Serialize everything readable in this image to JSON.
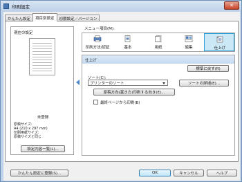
{
  "window": {
    "title": "印刷設定",
    "close_glyph": "✕"
  },
  "tabs": [
    {
      "label": "かんたん設定",
      "active": false
    },
    {
      "label": "項目別設定",
      "active": true
    },
    {
      "label": "初期設定／バージョン",
      "active": false
    }
  ],
  "left_panel": {
    "heading": "現在の設定",
    "status": "未登録",
    "info_lines": [
      "原稿サイズ:",
      "A4 (210 x 297 mm)",
      "印刷用紙サイズ:",
      "原稿サイズと同じ"
    ],
    "settings_list_button": "設定内容一覧(L)...",
    "register_button": "かんたん設定に登録(S)..."
  },
  "menu": {
    "label": "メニュー項目(M):",
    "items": [
      {
        "label": "印刷方法/認証",
        "icon": "print-method-icon"
      },
      {
        "label": "基本",
        "icon": "basic-icon"
      },
      {
        "label": "用紙",
        "icon": "paper-icon"
      },
      {
        "label": "編集",
        "icon": "edit-icon"
      },
      {
        "label": "仕上げ",
        "icon": "finish-icon",
        "selected": true
      }
    ]
  },
  "finishing": {
    "title": "仕上げ",
    "defaults_button": "標準に戻す(R)",
    "sort_label": "ソート(C):",
    "sort_value": "プリンターのソート",
    "sort_details_button": "ソートの詳細(E)...",
    "orientation_button": "原稿方向(置き方)印刷する向き(E)...",
    "last_page_checkbox_label": "最終ページから印刷(B)",
    "last_page_checked": false
  },
  "footer": {
    "ok": "OK",
    "cancel": "キャンセル",
    "help": "ヘルプ"
  },
  "colors": {
    "accent": "#26a0da",
    "selected_bg": "#cbe8f6",
    "frame": "#bfd3ea"
  }
}
